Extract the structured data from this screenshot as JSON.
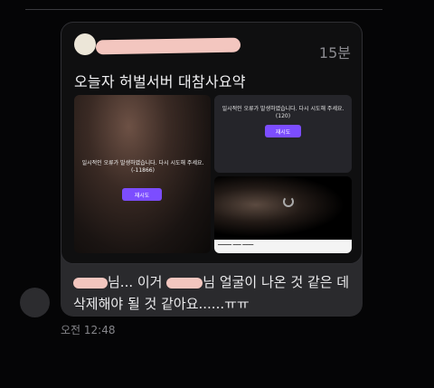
{
  "post": {
    "time_ago": "15분",
    "title": "오늘자 허벌서버 대참사요약",
    "images": {
      "left": {
        "error_text": "일시적인 오류가 발생하였습니다. 다시 시도해 주세요.(-11866)",
        "retry_label": "재시도"
      },
      "top_right": {
        "error_text": "일시적인 오류가 발생하였습니다. 다시 시도해 주세요.(120)",
        "retry_label": "재시도"
      }
    }
  },
  "message": {
    "part1": "님... 이거",
    "part2": "님 얼굴이 나온 것 같은 데 삭제해야 될 것 같아요......ㅠㅠ",
    "timestamp": "오전 12:48"
  },
  "colors": {
    "accent_purple": "#7c4dff",
    "bubble_bg": "#2a2a2d",
    "redaction": "#f3c6bf"
  }
}
